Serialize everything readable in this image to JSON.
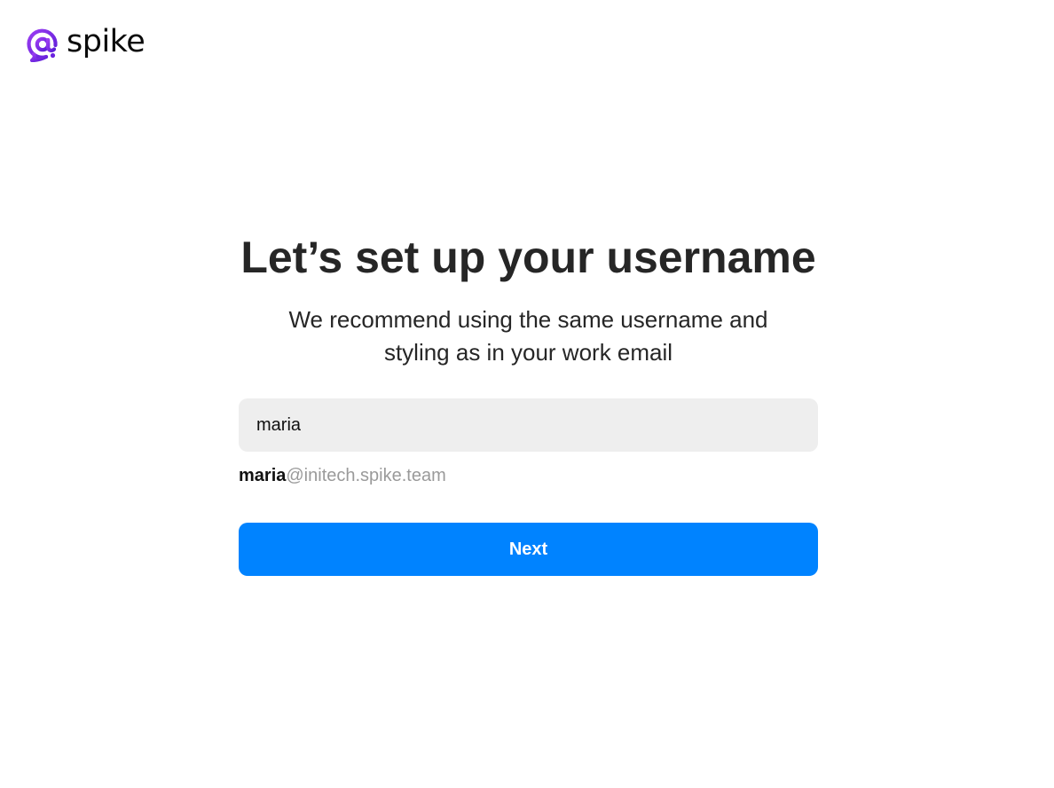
{
  "brand": {
    "name": "spike",
    "accent_color": "#7a26e6",
    "logo_icon": "spike-at-logo-icon"
  },
  "main": {
    "title": "Let’s set up your username",
    "subtitle": "We recommend using the same username and styling as in your work email",
    "username_input": {
      "value": "maria",
      "placeholder": ""
    },
    "address_preview": {
      "username": "maria",
      "domain": "@initech.spike.team"
    },
    "next_label": "Next",
    "next_color": "#0083ff"
  }
}
